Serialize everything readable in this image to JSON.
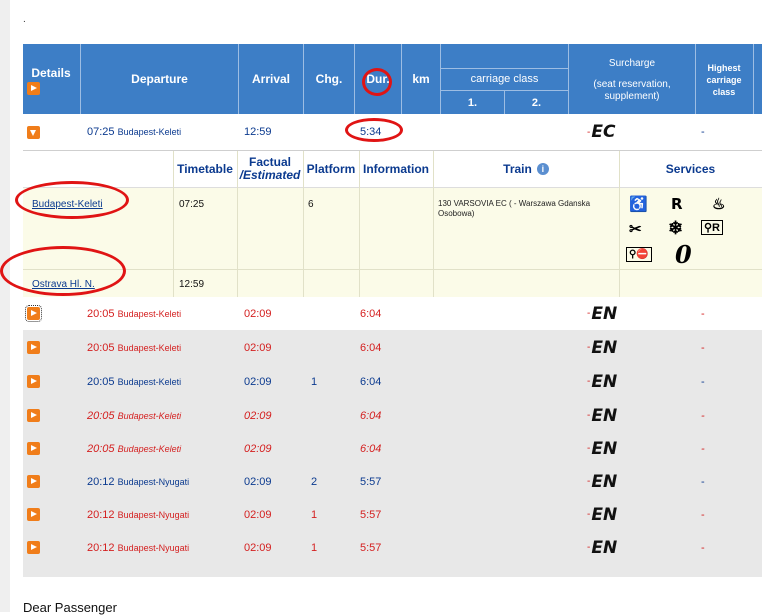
{
  "page": {
    "top_mark": "."
  },
  "header": {
    "details": "Details",
    "departure": "Departure",
    "arrival": "Arrival",
    "changes": "Chg.",
    "duration": "Dur.",
    "km": "km",
    "carriage_class": "carriage class",
    "class_1": "1.",
    "class_2": "2.",
    "surcharge": "Surcharge",
    "surcharge_note": "(seat reservation, supplement)",
    "highest_class": "Highest carriage class"
  },
  "expanded": {
    "time": "07:25",
    "station": "Budapest-Keleti",
    "arrival": "12:59",
    "duration": "5:34",
    "train_class": "EC",
    "highest": "-",
    "detail_headers": {
      "timetable": "Timetable",
      "factual": "Factual",
      "estimated": "/Estimated",
      "platform": "Platform",
      "information": "Information",
      "train": "Train",
      "services": "Services"
    },
    "stops": [
      {
        "station": "Budapest-Keleti",
        "time": "07:25",
        "platform": "6"
      },
      {
        "station": "Ostrava Hl. N.",
        "time": "12:59",
        "platform": ""
      }
    ],
    "train_info": "130  VARSOVIA  EC ( - Warszawa Gdanska Osobowa)",
    "services": [
      "wheelchair-icon",
      "reservation-R-icon",
      "restaurant-icon",
      "ticket-inspection-icon",
      "air-conditioning-icon",
      "bicycle-reservation-icon",
      "no-bicycle-icon",
      "zero-icon"
    ]
  },
  "rows": [
    {
      "time": "20:05",
      "station": "Budapest-Keleti",
      "arrival": "02:09",
      "platform": "",
      "duration": "6:04",
      "train_class": "EN",
      "highest": "-",
      "style": "red"
    },
    {
      "time": "20:05",
      "station": "Budapest-Keleti",
      "arrival": "02:09",
      "platform": "",
      "duration": "6:04",
      "train_class": "EN",
      "highest": "-",
      "style": "red"
    },
    {
      "time": "20:05",
      "station": "Budapest-Keleti",
      "arrival": "02:09",
      "platform": "1",
      "duration": "6:04",
      "train_class": "EN",
      "highest": "-",
      "style": "blue"
    },
    {
      "time": "20:05",
      "station": "Budapest-Keleti",
      "arrival": "02:09",
      "platform": "",
      "duration": "6:04",
      "train_class": "EN",
      "highest": "-",
      "style": "red-italic"
    },
    {
      "time": "20:05",
      "station": "Budapest-Keleti",
      "arrival": "02:09",
      "platform": "",
      "duration": "6:04",
      "train_class": "EN",
      "highest": "-",
      "style": "red-italic"
    },
    {
      "time": "20:12",
      "station": "Budapest-Nyugati",
      "arrival": "02:09",
      "platform": "2",
      "duration": "5:57",
      "train_class": "EN",
      "highest": "-",
      "style": "blue"
    },
    {
      "time": "20:12",
      "station": "Budapest-Nyugati",
      "arrival": "02:09",
      "platform": "1",
      "duration": "5:57",
      "train_class": "EN",
      "highest": "-",
      "style": "red"
    },
    {
      "time": "20:12",
      "station": "Budapest-Nyugati",
      "arrival": "02:09",
      "platform": "1",
      "duration": "5:57",
      "train_class": "EN",
      "highest": "-",
      "style": "red"
    }
  ],
  "footer": {
    "text": "Dear Passenger"
  },
  "colors": {
    "header_bg": "#3d7ec6",
    "play_button": "#f07d1a",
    "annotation": "#e01414",
    "late_text": "#d41f1f",
    "ontime_text": "#0b3a8f"
  }
}
